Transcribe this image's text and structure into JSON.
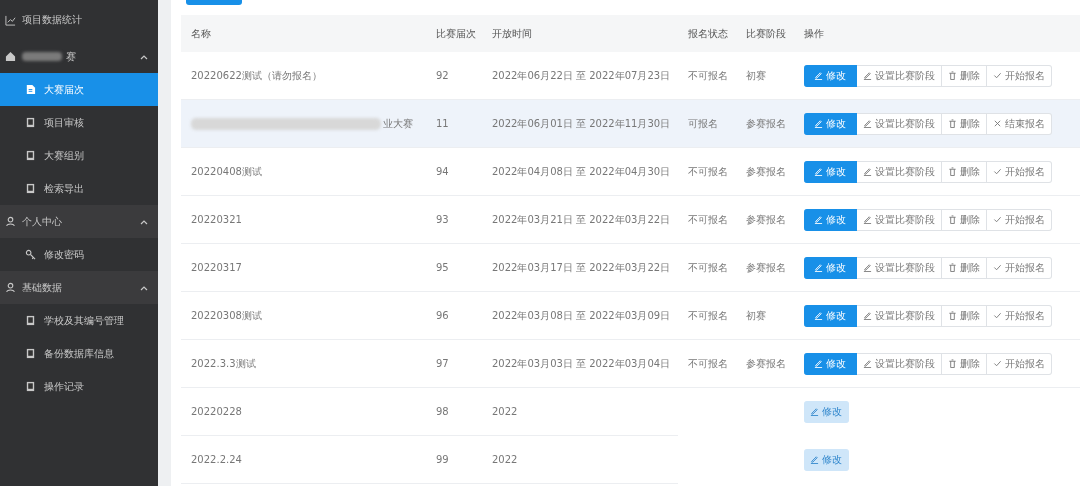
{
  "sidebar": {
    "items": [
      {
        "kind": "link",
        "label": "项目数据统计"
      },
      {
        "kind": "group",
        "label": "赛",
        "redacted": true,
        "expanded": true,
        "children": [
          {
            "label": "大赛届次",
            "selected": true
          },
          {
            "label": "项目审核",
            "selected": false
          },
          {
            "label": "大赛组别",
            "selected": false
          },
          {
            "label": "检索导出",
            "selected": false
          }
        ]
      },
      {
        "kind": "group",
        "label": "个人中心",
        "redacted": false,
        "expanded": true,
        "children": [
          {
            "label": "修改密码",
            "selected": false
          }
        ]
      },
      {
        "kind": "group",
        "label": "基础数据",
        "redacted": false,
        "expanded": true,
        "children": [
          {
            "label": "学校及其编号管理",
            "selected": false
          },
          {
            "label": "备份数据库信息",
            "selected": false
          },
          {
            "label": "操作记录",
            "selected": false
          }
        ]
      }
    ]
  },
  "table": {
    "columns": [
      "名称",
      "比赛届次",
      "开放时间",
      "报名状态",
      "比赛阶段",
      "操作"
    ],
    "rows": [
      {
        "kind": "full",
        "name": "20220622测试（请勿报名）",
        "redacted": false,
        "hovered": false,
        "round": "92",
        "period": "2022年06月22日 至 2022年07月23日",
        "status": "不可报名",
        "stage": "初赛",
        "actions": [
          "修改",
          "设置比赛阶段",
          "删除"
        ],
        "toggle": {
          "kind": "start",
          "label": "开始报名"
        }
      },
      {
        "kind": "full",
        "name": "业大赛",
        "redacted": true,
        "hovered": true,
        "round": "11",
        "period": "2022年06月01日 至 2022年11月30日",
        "status": "可报名",
        "stage": "参赛报名",
        "actions": [
          "修改",
          "设置比赛阶段",
          "删除"
        ],
        "toggle": {
          "kind": "end",
          "label": "结束报名"
        }
      },
      {
        "kind": "full",
        "name": "20220408测试",
        "redacted": false,
        "hovered": false,
        "round": "94",
        "period": "2022年04月08日 至 2022年04月30日",
        "status": "不可报名",
        "stage": "参赛报名",
        "actions": [
          "修改",
          "设置比赛阶段",
          "删除"
        ],
        "toggle": {
          "kind": "start",
          "label": "开始报名"
        }
      },
      {
        "kind": "full",
        "name": "20220321",
        "redacted": false,
        "hovered": false,
        "round": "93",
        "period": "2022年03月21日 至 2022年03月22日",
        "status": "不可报名",
        "stage": "参赛报名",
        "actions": [
          "修改",
          "设置比赛阶段",
          "删除"
        ],
        "toggle": {
          "kind": "start",
          "label": "开始报名"
        }
      },
      {
        "kind": "full",
        "name": "20220317",
        "redacted": false,
        "hovered": false,
        "round": "95",
        "period": "2022年03月17日 至 2022年03月22日",
        "status": "不可报名",
        "stage": "参赛报名",
        "actions": [
          "修改",
          "设置比赛阶段",
          "删除"
        ],
        "toggle": {
          "kind": "start",
          "label": "开始报名"
        }
      },
      {
        "kind": "full",
        "name": "20220308测试",
        "redacted": false,
        "hovered": false,
        "round": "96",
        "period": "2022年03月08日 至 2022年03月09日",
        "status": "不可报名",
        "stage": "初赛",
        "actions": [
          "修改",
          "设置比赛阶段",
          "删除"
        ],
        "toggle": {
          "kind": "start",
          "label": "开始报名"
        }
      },
      {
        "kind": "full",
        "name": "2022.3.3测试",
        "redacted": false,
        "hovered": false,
        "round": "97",
        "period": "2022年03月03日 至 2022年03月04日",
        "status": "不可报名",
        "stage": "参赛报名",
        "actions": [
          "修改",
          "设置比赛阶段",
          "删除"
        ],
        "toggle": {
          "kind": "start",
          "label": "开始报名"
        }
      },
      {
        "kind": "covered",
        "name": "20220228",
        "round": "98",
        "period": "2022",
        "edit": "修改"
      },
      {
        "kind": "covered",
        "name": "2022.2.24",
        "round": "99",
        "period": "2022",
        "edit": "修改"
      }
    ]
  }
}
